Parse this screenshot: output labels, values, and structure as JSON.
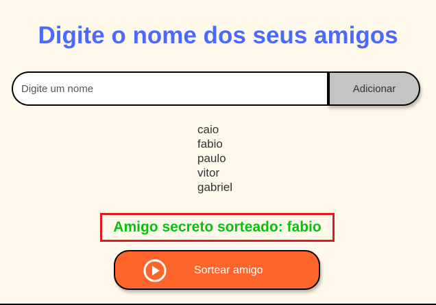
{
  "header": {
    "title": "Digite o nome dos seus amigos"
  },
  "form": {
    "input_placeholder": "Digite um nome",
    "input_value": "",
    "add_label": "Adicionar"
  },
  "friends": [
    "caio",
    "fabio",
    "paulo",
    "vitor",
    "gabriel"
  ],
  "result": {
    "text": "Amigo secreto sorteado: fabio"
  },
  "draw_button": {
    "label": "Sortear amigo",
    "icon": "play-circle-icon"
  },
  "colors": {
    "background": "#FFF9EB",
    "title": "#4B69FD",
    "result_text": "#05C20C",
    "result_border": "#E0191F",
    "draw_button": "#FE652B",
    "add_button": "#C4C4C4"
  }
}
